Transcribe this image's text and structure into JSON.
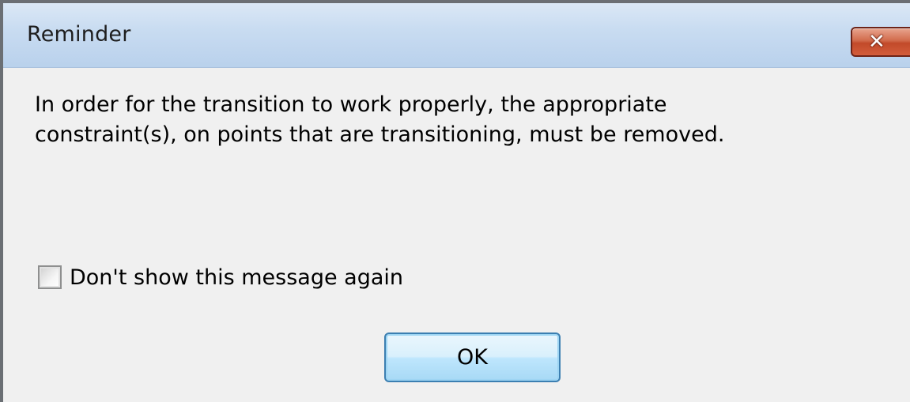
{
  "dialog": {
    "title": "Reminder",
    "close_icon": "close-icon",
    "close_glyph": "✕",
    "message_lines": [
      "In order for the transition to work properly, the appropriate",
      "constraint(s), on points that are transitioning, must be removed."
    ],
    "checkbox": {
      "label": "Don't show this message again",
      "checked": false
    },
    "ok_label": "OK"
  },
  "colors": {
    "close_button": "#c24a2a",
    "ok_button_border": "#3c7fb1",
    "titlebar": "#c9dcf1"
  }
}
